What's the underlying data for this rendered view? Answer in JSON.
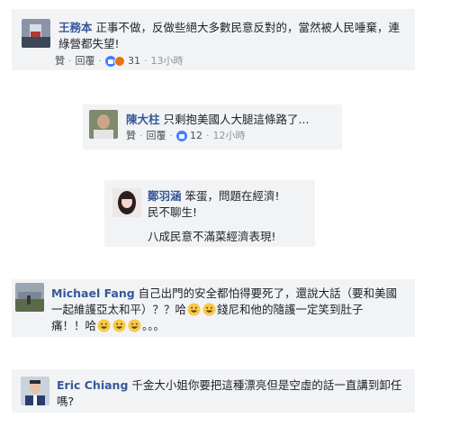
{
  "comments": [
    {
      "author": "王務本",
      "lines": [
        "正事不做，反做些絕大多數民意反對的，當然被人民唾棄，連",
        "綠營都失望!"
      ],
      "actions": {
        "like": "贊",
        "reply": "回覆",
        "count": "31",
        "time": "13小時"
      },
      "reactions": [
        "like-icon",
        "angry-icon"
      ]
    },
    {
      "author": "陳大柱",
      "lines": [
        "只剩抱美國人大腿這條路了..."
      ],
      "actions": {
        "like": "贊",
        "reply": "回覆",
        "count": "12",
        "time": "12小時"
      },
      "reactions": [
        "like-icon"
      ]
    },
    {
      "author": "鄭羽涵",
      "lines": [
        "笨蛋，問題在經濟!",
        "民不聊生!",
        "八成民意不滿菜經濟表現!"
      ]
    },
    {
      "author": "Michael Fang",
      "lines": [
        "自己出門的安全都怕得要死了，還說大話（要和美國",
        "一起維護亞太和平）？？哈",
        "錢尼和他的隨護一定笑到肚子",
        "痛！！哈",
        "。。。"
      ]
    },
    {
      "author": "Eric Chiang",
      "lines": [
        "千金大小姐你要把這種漂亮但是空虛的話一直講到卸任",
        "嗎?"
      ]
    }
  ],
  "colors": {
    "link": "#365899",
    "card_bg": "#f2f3f5",
    "meta": "#90949c"
  },
  "icons": {
    "emoji": "grinning-face-emoji"
  }
}
